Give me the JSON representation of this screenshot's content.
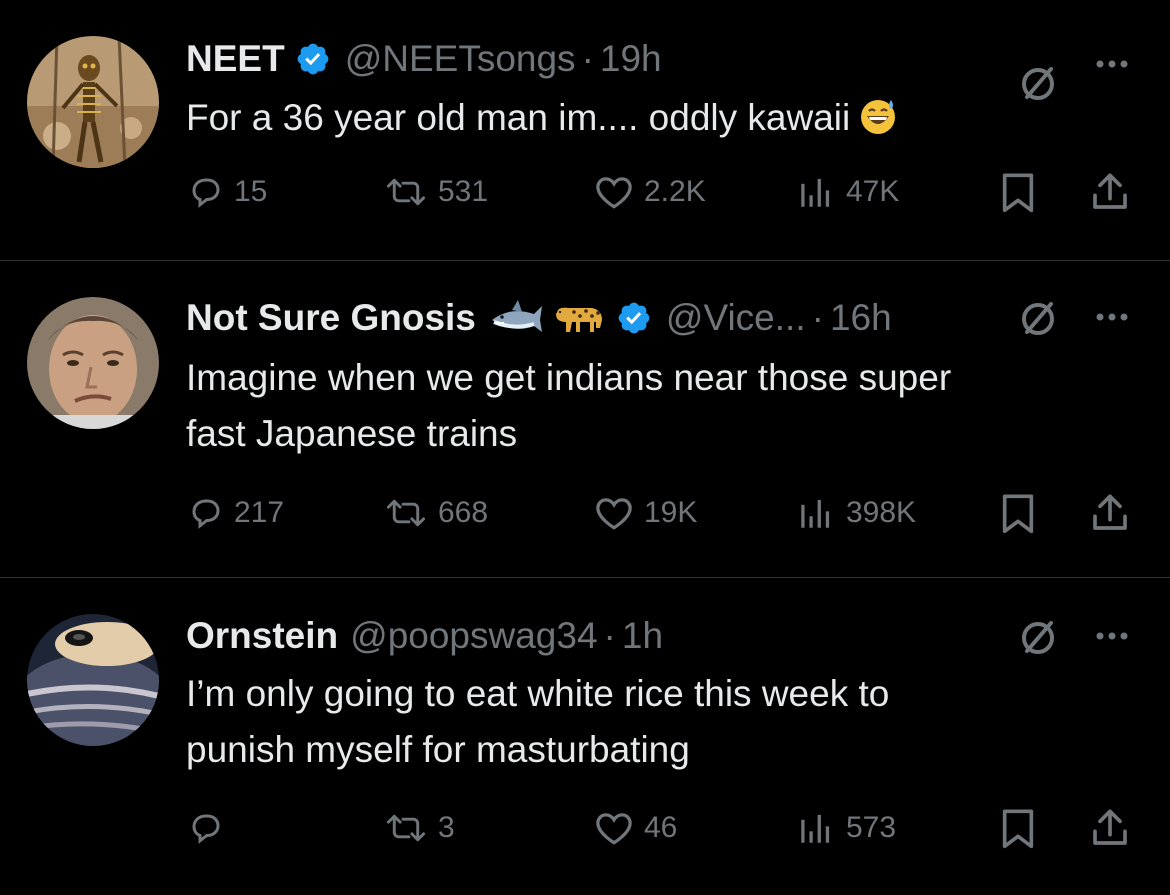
{
  "colors": {
    "background": "#000000",
    "text_primary": "#e7e9ea",
    "text_secondary": "#71767b",
    "verified_blue": "#1d9bf0",
    "divider": "#2f3336"
  },
  "icons": {
    "reply": "reply-icon",
    "repost": "repost-icon",
    "like": "heart-icon",
    "views": "views-icon",
    "bookmark": "bookmark-icon",
    "share": "share-icon",
    "grok": "grok-icon",
    "more": "more-icon",
    "verified": "verified-badge-icon"
  },
  "tweets": [
    {
      "display_name": "NEET",
      "handle": "@NEETsongs",
      "separator": "·",
      "time": "19h",
      "verified": true,
      "name_emojis": [],
      "text_lines": [
        "For a 36 year old man im.... oddly kawaii"
      ],
      "text_emoji": "grinning-sweat-emoji",
      "replies": "15",
      "reposts": "531",
      "likes": "2.2K",
      "views": "47K"
    },
    {
      "display_name": "Not Sure Gnosis",
      "handle": "@Vice...",
      "separator": "·",
      "time": "16h",
      "verified": true,
      "name_emojis": [
        "shark-emoji",
        "leopard-emoji"
      ],
      "text_lines": [
        "Imagine when we get indians near those super",
        "fast Japanese trains"
      ],
      "replies": "217",
      "reposts": "668",
      "likes": "19K",
      "views": "398K"
    },
    {
      "display_name": "Ornstein",
      "handle": "@poopswag34",
      "separator": "·",
      "time": "1h",
      "verified": false,
      "name_emojis": [],
      "text_lines": [
        "I’m only going to eat white rice this week to",
        "punish myself for masturbating"
      ],
      "replies": "",
      "reposts": "3",
      "likes": "46",
      "views": "573"
    }
  ]
}
